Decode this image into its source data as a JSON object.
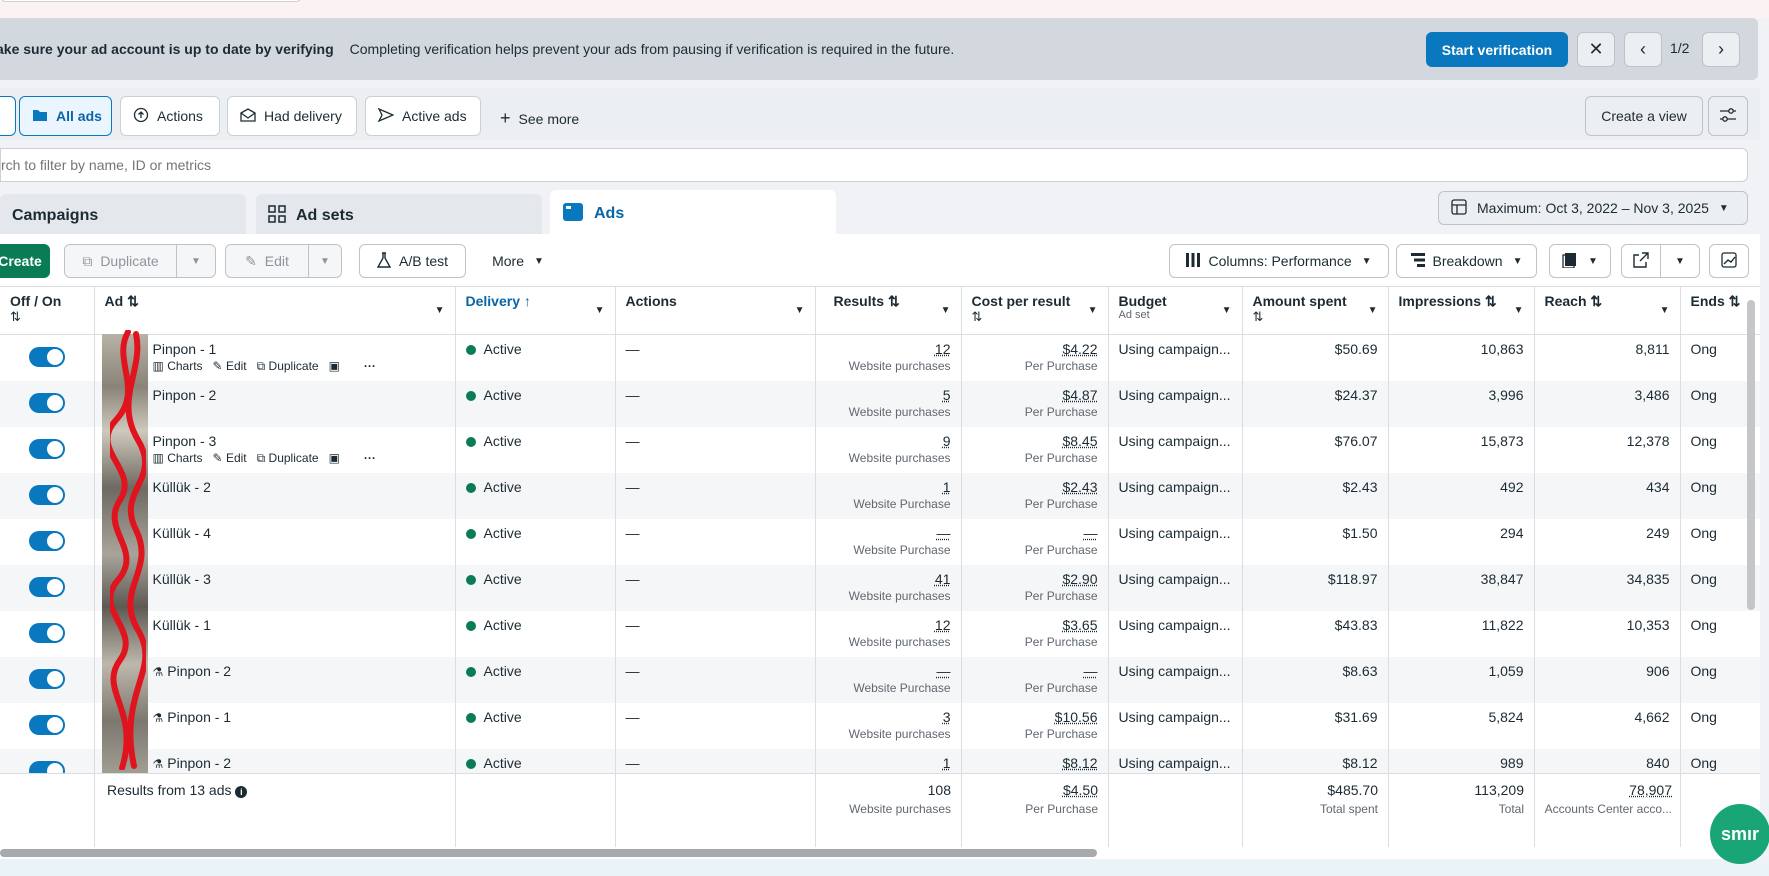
{
  "banner": {
    "title": "ake sure your ad account is up to date by verifying",
    "text": "Completing verification helps prevent your ads from pausing if verification is required in the future.",
    "primary_button": "Start verification",
    "pager": "1/2"
  },
  "filters": {
    "pills": [
      "All ads",
      "Actions",
      "Had delivery",
      "Active ads"
    ],
    "see_more": "See more",
    "create_view": "Create a view"
  },
  "search": {
    "placeholder": "rch to filter by name, ID or metrics"
  },
  "level_tabs": [
    "Campaigns",
    "Ad sets",
    "Ads"
  ],
  "date_range": "Maximum: Oct 3, 2022 – Nov 3, 2025",
  "toolbar": {
    "create": "Create",
    "duplicate": "Duplicate",
    "edit": "Edit",
    "ab_test": "A/B test",
    "more": "More",
    "columns": "Columns: Performance",
    "breakdown": "Breakdown"
  },
  "columns": {
    "off_on": "Off / On",
    "ad": "Ad",
    "delivery": "Delivery",
    "actions": "Actions",
    "results": "Results",
    "cost_per_result": "Cost per result",
    "budget": "Budget",
    "budget_sub": "Ad set",
    "amount_spent": "Amount spent",
    "impressions": "Impressions",
    "reach": "Reach",
    "ends": "Ends"
  },
  "row_actions": {
    "charts": "Charts",
    "edit": "Edit",
    "duplicate": "Duplicate"
  },
  "rows": [
    {
      "name": "Pinpon - 1",
      "beaker": false,
      "show_actions": true,
      "delivery": "Active",
      "actions": "—",
      "results": "12",
      "results_sub": "Website purchases",
      "cpr": "$4.22",
      "cpr_sub": "Per Purchase",
      "budget": "Using campaign...",
      "spent": "$50.69",
      "impressions": "10,863",
      "reach": "8,811",
      "ends": "Ong"
    },
    {
      "name": "Pinpon - 2",
      "beaker": false,
      "show_actions": false,
      "delivery": "Active",
      "actions": "—",
      "results": "5",
      "results_sub": "Website purchases",
      "cpr": "$4.87",
      "cpr_sub": "Per Purchase",
      "budget": "Using campaign...",
      "spent": "$24.37",
      "impressions": "3,996",
      "reach": "3,486",
      "ends": "Ong"
    },
    {
      "name": "Pinpon - 3",
      "beaker": false,
      "show_actions": true,
      "delivery": "Active",
      "actions": "—",
      "results": "9",
      "results_sub": "Website purchases",
      "cpr": "$8.45",
      "cpr_sub": "Per Purchase",
      "budget": "Using campaign...",
      "spent": "$76.07",
      "impressions": "15,873",
      "reach": "12,378",
      "ends": "Ong"
    },
    {
      "name": "Küllük - 2",
      "beaker": false,
      "show_actions": false,
      "delivery": "Active",
      "actions": "—",
      "results": "1",
      "results_sub": "Website Purchase",
      "cpr": "$2.43",
      "cpr_sub": "Per Purchase",
      "budget": "Using campaign...",
      "spent": "$2.43",
      "impressions": "492",
      "reach": "434",
      "ends": "Ong"
    },
    {
      "name": "Küllük - 4",
      "beaker": false,
      "show_actions": false,
      "delivery": "Active",
      "actions": "—",
      "results": "—",
      "results_sub": "Website Purchase",
      "cpr": "—",
      "cpr_sub": "Per Purchase",
      "budget": "Using campaign...",
      "spent": "$1.50",
      "impressions": "294",
      "reach": "249",
      "ends": "Ong"
    },
    {
      "name": "Küllük - 3",
      "beaker": false,
      "show_actions": false,
      "delivery": "Active",
      "actions": "—",
      "results": "41",
      "results_sub": "Website purchases",
      "cpr": "$2.90",
      "cpr_sub": "Per Purchase",
      "budget": "Using campaign...",
      "spent": "$118.97",
      "impressions": "38,847",
      "reach": "34,835",
      "ends": "Ong"
    },
    {
      "name": "Küllük - 1",
      "beaker": false,
      "show_actions": false,
      "delivery": "Active",
      "actions": "—",
      "results": "12",
      "results_sub": "Website purchases",
      "cpr": "$3.65",
      "cpr_sub": "Per Purchase",
      "budget": "Using campaign...",
      "spent": "$43.83",
      "impressions": "11,822",
      "reach": "10,353",
      "ends": "Ong"
    },
    {
      "name": "Pinpon - 2",
      "beaker": true,
      "show_actions": false,
      "delivery": "Active",
      "actions": "—",
      "results": "—",
      "results_sub": "Website Purchase",
      "cpr": "—",
      "cpr_sub": "Per Purchase",
      "budget": "Using campaign...",
      "spent": "$8.63",
      "impressions": "1,059",
      "reach": "906",
      "ends": "Ong"
    },
    {
      "name": "Pinpon - 1",
      "beaker": true,
      "show_actions": false,
      "delivery": "Active",
      "actions": "—",
      "results": "3",
      "results_sub": "Website purchases",
      "cpr": "$10.56",
      "cpr_sub": "Per Purchase",
      "budget": "Using campaign...",
      "spent": "$31.69",
      "impressions": "5,824",
      "reach": "4,662",
      "ends": "Ong"
    },
    {
      "name": "Pinpon - 2",
      "beaker": true,
      "show_actions": false,
      "delivery": "Active",
      "actions": "—",
      "results": "1",
      "results_sub": "",
      "cpr": "$8.12",
      "cpr_sub": "",
      "budget": "Using campaign...",
      "spent": "$8.12",
      "impressions": "989",
      "reach": "840",
      "ends": "Ong"
    }
  ],
  "summary": {
    "label": "Results from 13 ads",
    "results": "108",
    "results_sub": "Website purchases",
    "cpr": "$4.50",
    "cpr_sub": "Per Purchase",
    "spent": "$485.70",
    "spent_sub": "Total spent",
    "impressions": "113,209",
    "impressions_sub": "Total",
    "reach": "78,907",
    "reach_sub": "Accounts Center acco..."
  },
  "fab_label": "smır",
  "colors": {
    "accent": "#0a78be",
    "create_green": "#0a7c55",
    "scribble_red": "#e0141e"
  }
}
